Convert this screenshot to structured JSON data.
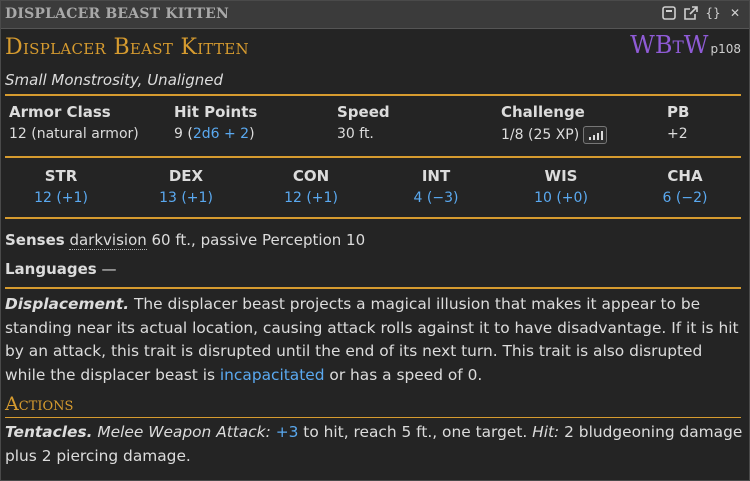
{
  "window": {
    "title": "DISPLACER BEAST KITTEN"
  },
  "toolbar": {
    "icons": [
      "collapse-icon",
      "popout-icon",
      "json-icon",
      "close-icon"
    ],
    "json_glyph": "{}",
    "close_glyph": "✕"
  },
  "monster": {
    "name": "Displacer Beast Kitten",
    "source_abbr": "WBtW",
    "source_page": "p108",
    "type": "Small Monstrosity, Unaligned"
  },
  "stats": {
    "ac_label": "Armor Class",
    "ac_value": "12 (natural armor)",
    "hp_label": "Hit Points",
    "hp_prefix": "9 (",
    "hp_dice": "2d6 + 2",
    "hp_suffix": ")",
    "speed_label": "Speed",
    "speed_value": "30 ft.",
    "cr_label": "Challenge",
    "cr_value": "1/8 (25 XP)",
    "pb_label": "PB",
    "pb_value": "+2"
  },
  "abilities": [
    {
      "name": "STR",
      "value": "12 (+1)"
    },
    {
      "name": "DEX",
      "value": "13 (+1)"
    },
    {
      "name": "CON",
      "value": "12 (+1)"
    },
    {
      "name": "INT",
      "value": "4 (−3)"
    },
    {
      "name": "WIS",
      "value": "10 (+0)"
    },
    {
      "name": "CHA",
      "value": "6 (−2)"
    }
  ],
  "senses": {
    "label": "Senses",
    "link": "darkvision",
    "rest": " 60 ft., passive Perception 10"
  },
  "languages": {
    "label": "Languages",
    "value": " —"
  },
  "trait": {
    "name": "Displacement.",
    "text_1": " The displacer beast projects a magical illusion that makes it appear to be standing near its actual location, causing attack rolls against it to have disadvantage. If it is hit by an attack, this trait is disrupted until the end of its next turn. This trait is also disrupted while the displacer beast is ",
    "link": "incapacitated",
    "text_2": " or has a speed of 0."
  },
  "actions": {
    "header": "Actions",
    "name": "Tentacles.",
    "attack_type": " Melee Weapon Attack:",
    "to_hit": "+3",
    "text_1": " to hit, reach 5 ft., one target. ",
    "hit_label": "Hit:",
    "text_2": " 2 bludgeoning damage plus 2 piercing damage."
  },
  "colors": {
    "accent": "#d69b2f",
    "link": "#5aa9f0",
    "source": "#8f5bd6",
    "background": "#242424"
  }
}
